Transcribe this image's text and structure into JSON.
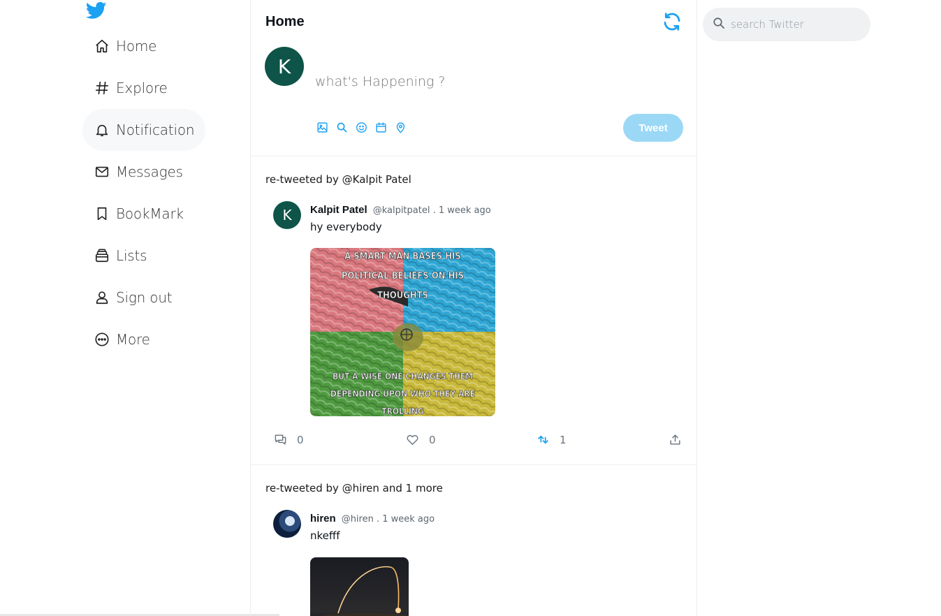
{
  "sidebar": {
    "items": [
      {
        "label": "Home",
        "icon": "home-icon"
      },
      {
        "label": "Explore",
        "icon": "hashtag-icon"
      },
      {
        "label": "Notification",
        "icon": "bell-icon"
      },
      {
        "label": "Messages",
        "icon": "envelope-icon"
      },
      {
        "label": "BookMark",
        "icon": "bookmark-icon"
      },
      {
        "label": "Lists",
        "icon": "list-icon"
      },
      {
        "label": "Sign out",
        "icon": "user-icon"
      },
      {
        "label": "More",
        "icon": "more-icon"
      }
    ],
    "active": "Notification"
  },
  "header": {
    "title": "Home"
  },
  "composer": {
    "avatar_letter": "K",
    "placeholder": "what's Happening ?",
    "tweet_label": "Tweet",
    "tools": [
      "image-icon",
      "search-icon",
      "emoji-icon",
      "calendar-icon",
      "location-icon"
    ]
  },
  "search": {
    "placeholder": "search Twitter"
  },
  "tweets": [
    {
      "retweeted_by": "re-tweeted by @Kalpit Patel",
      "avatar_letter": "K",
      "name": "Kalpit Patel",
      "meta": "@kalpitpatel . 1 week ago",
      "text": "hy everybody",
      "image_caption_top": "A SMART MAN BASES HIS POLITICAL BELIEFS ON HIS THOUGHTS",
      "image_caption_bottom": "BUT A WISE ONE CHANGES THEM DEPENDING UPON WHO THEY ARE TROLLING",
      "replies": "0",
      "likes": "0",
      "retweets": "1"
    },
    {
      "retweeted_by": "re-tweeted by @hiren and 1 more",
      "name": "hiren",
      "meta": "@hiren . 1 week ago",
      "text": "nkefff"
    }
  ],
  "colors": {
    "accent": "#1da1f2",
    "avatar_bg": "#0e5448",
    "tweet_button_disabled": "#9bd8f5"
  }
}
